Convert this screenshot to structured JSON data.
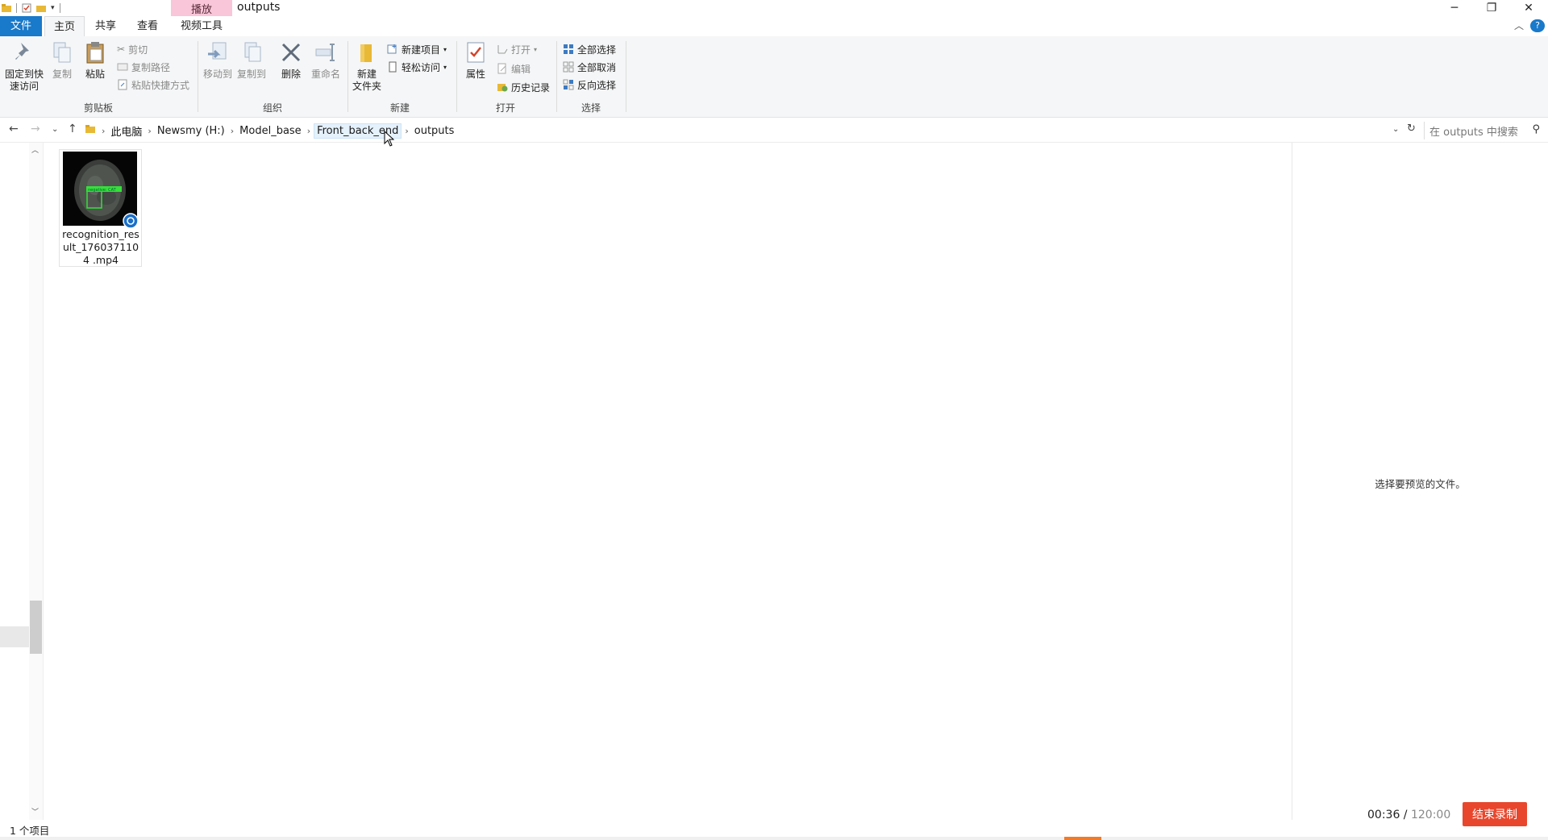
{
  "window": {
    "title": "outputs",
    "context_tab": "播放",
    "controls": {
      "minimize": "─",
      "restore": "❐",
      "close": "✕"
    }
  },
  "tabs": [
    {
      "label": "文件"
    },
    {
      "label": "主页"
    },
    {
      "label": "共享"
    },
    {
      "label": "查看"
    },
    {
      "label": "视频工具"
    }
  ],
  "ribbon": {
    "clipboard": {
      "pin": "固定到快速访问",
      "pin_line1": "固定到快",
      "pin_line2": "速访问",
      "copy": "复制",
      "paste": "粘贴",
      "cut": "剪切",
      "copy_path": "复制路径",
      "paste_shortcut": "粘贴快捷方式",
      "label": "剪贴板"
    },
    "organize": {
      "move_to": "移动到",
      "copy_to": "复制到",
      "delete": "删除",
      "rename": "重命名",
      "label": "组织"
    },
    "new": {
      "new_folder_line1": "新建",
      "new_folder_line2": "文件夹",
      "new_item": "新建项目",
      "easy_access": "轻松访问",
      "label": "新建"
    },
    "open": {
      "properties": "属性",
      "open": "打开",
      "edit": "编辑",
      "history": "历史记录",
      "label": "打开"
    },
    "select": {
      "select_all": "全部选择",
      "select_none": "全部取消",
      "invert": "反向选择",
      "label": "选择"
    }
  },
  "address": {
    "crumbs": [
      "此电脑",
      "Newsmy (H:)",
      "Model_base",
      "Front_back_end",
      "outputs"
    ],
    "search_placeholder": "在 outputs 中搜索"
  },
  "files": [
    {
      "name": "recognition_result_1760371104.mp4",
      "name_display": "recognition_res ult_1760371104 .mp4",
      "thumb_label": "negative: CAT"
    }
  ],
  "preview": {
    "message": "选择要预览的文件。"
  },
  "status": {
    "item_count": "1 个项目"
  },
  "recorder": {
    "elapsed": "00:36 /",
    "total": "120:00",
    "stop_label": "结束录制"
  },
  "colors": {
    "accent": "#1979ca",
    "context_tab": "#f8c6d8",
    "stop_button": "#e8472d"
  }
}
